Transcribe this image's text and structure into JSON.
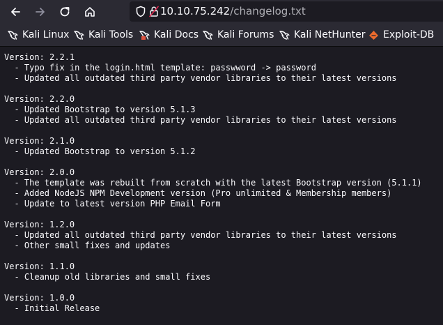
{
  "address_bar": {
    "host": "10.10.75.242",
    "path": "/changelog.txt"
  },
  "bookmarks": [
    {
      "label": "Kali Linux",
      "icon": "kali-dragon-icon"
    },
    {
      "label": "Kali Tools",
      "icon": "kali-dragon-icon"
    },
    {
      "label": "Kali Docs",
      "icon": "kali-docs-icon"
    },
    {
      "label": "Kali Forums",
      "icon": "kali-dragon-icon"
    },
    {
      "label": "Kali NetHunter",
      "icon": "kali-dragon-icon"
    },
    {
      "label": "Exploit-DB",
      "icon": "exploit-db-icon"
    }
  ],
  "changelog_text": "Version: 2.2.1\n  - Typo fix in the login.html template: passwword -> password\n  - Updated all outdated third party vendor libraries to their latest versions\n\nVersion: 2.2.0\n  - Updated Bootstrap to version 5.1.3\n  - Updated all outdated third party vendor libraries to their latest versions\n\nVersion: 2.1.0\n  - Updated Bootstrap to version 5.1.2\n\nVersion: 2.0.0\n  - The template was rebuilt from scratch with the latest Bootstrap version (5.1.1)\n  - Added NodeJS NPM Development version (Pro unlimited & Membership members)\n  - Update to latest version PHP Email Form\n\nVersion: 1.2.0\n  - Updated all outdated third party vendor libraries to their latest versions\n  - Other small fixes and updates\n\nVersion: 1.1.0\n  - Cleanup old libraries and small fixes\n\nVersion: 1.0.0\n  - Initial Release",
  "colors": {
    "toolbar_bg": "#2b2a33",
    "page_bg": "#1c1b22",
    "text": "#fbfbfe",
    "url_path": "#aeaeb4",
    "exploit_db_accent": "#ec6b2d"
  }
}
